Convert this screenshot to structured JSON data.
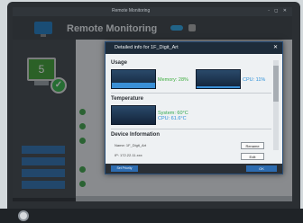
{
  "window": {
    "title": "Remote Monitoring",
    "controls": "- ◻ ✕"
  },
  "app": {
    "name": "Remote Monitoring"
  },
  "device_tile": {
    "label": "5"
  },
  "sidebar": {
    "buttons": [
      "",
      "",
      "",
      ""
    ]
  },
  "dialog": {
    "title": "Detailed info for 1F_Digit_Art",
    "close": "✕",
    "usage": {
      "heading": "Usage",
      "memory_label": "Memory: 28%",
      "memory_value": 28,
      "cpu_label": "CPU: 11%",
      "cpu_value": 11
    },
    "temperature": {
      "heading": "Temperature",
      "system_label": "System: 60°C",
      "cpu_label": "CPU: 61.6°C"
    },
    "device_info": {
      "heading": "Device Information",
      "name_label": "Name: 1F_Digit_Art",
      "ip_label": "IP: 172.22.11.xxx",
      "rename_button": "Rename",
      "second_button": "Edit"
    },
    "footer": {
      "set_priority": "Set Priority",
      "ok": "OK"
    }
  },
  "colors": {
    "accent": "#2d6cb0",
    "usage_memory": "#3fae3f",
    "usage_cpu": "#2b8fd8",
    "temp_system": "#2fa84f",
    "temp_cpu": "#2b8fd8",
    "ok_badge": "#36b44a"
  }
}
